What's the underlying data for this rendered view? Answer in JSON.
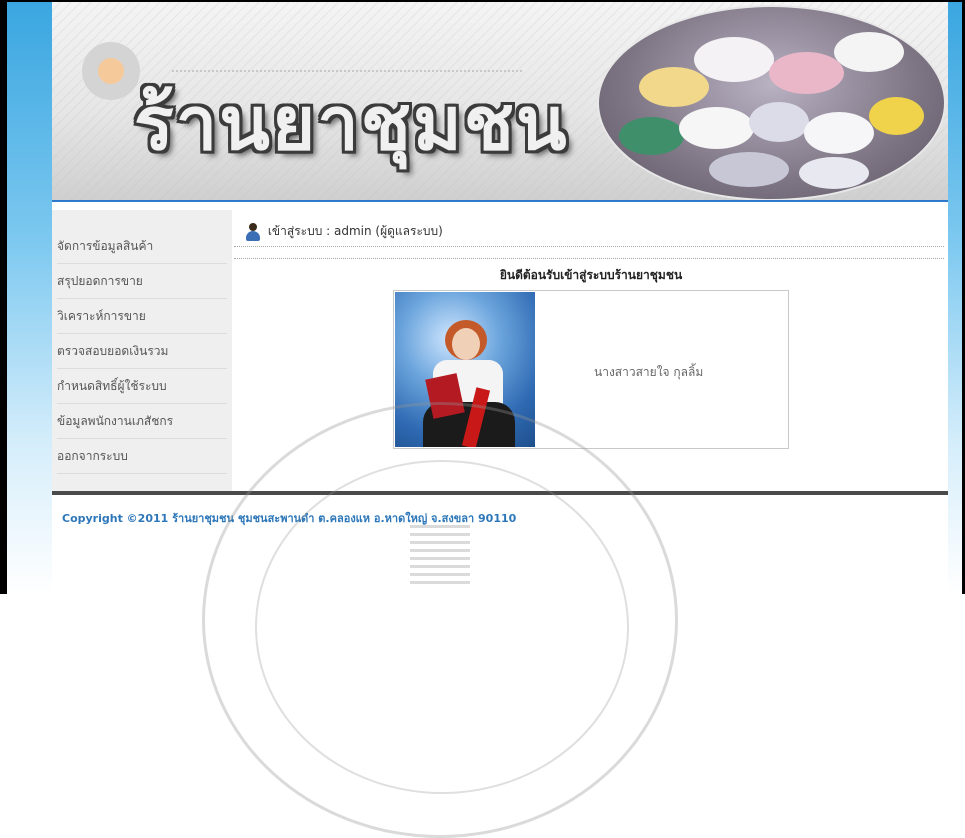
{
  "header": {
    "title": "ร้านยาชุมชน"
  },
  "sidebar": {
    "items": [
      {
        "label": "จัดการข้อมูลสินค้า"
      },
      {
        "label": "สรุปยอดการขาย"
      },
      {
        "label": "วิเคราะห์การขาย"
      },
      {
        "label": "ตรวจสอบยอดเงินรวม"
      },
      {
        "label": "กำหนดสิทธิ์ผู้ใช้ระบบ"
      },
      {
        "label": "ข้อมูลพนักงานเภสัชกร"
      },
      {
        "label": "ออกจากระบบ"
      }
    ]
  },
  "main": {
    "login_status": "เข้าสู่ระบบ : admin (ผู้ดูแลระบบ)",
    "welcome": "ยินดีต้อนรับเข้าสู่ระบบร้านยาชุมชน",
    "profile_name": "นางสาวสายใจ กุลลิ้ม"
  },
  "footer": {
    "copyright": "Copyright ©2011 ร้านยาชุมชน ชุมชนสะพานดำ ต.คลองแห อ.หาดใหญ่ จ.สงขลา 90110"
  },
  "icons": {
    "user": "user-icon"
  },
  "colors": {
    "accent_bar": "#2a78c9",
    "footer_text": "#2d77b9",
    "menu_bg": "#efefef"
  }
}
